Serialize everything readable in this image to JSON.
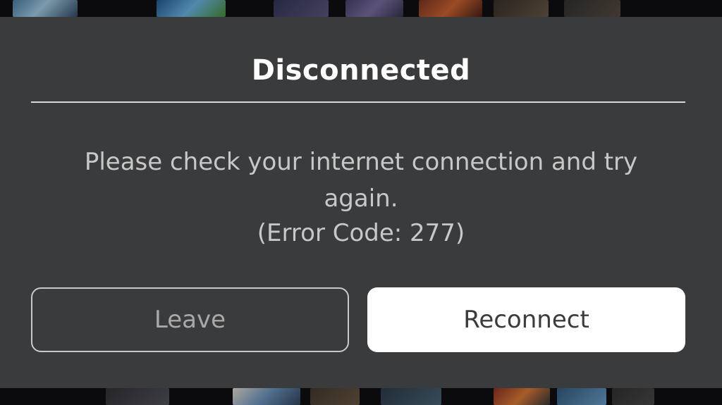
{
  "dialog": {
    "title": "Disconnected",
    "message_line1": "Please check your internet connection and try",
    "message_line2": "again.",
    "error_code": "(Error Code: 277)",
    "buttons": {
      "leave_label": "Leave",
      "reconnect_label": "Reconnect"
    }
  },
  "colors": {
    "dialog_background": "#393b3d",
    "title_text": "#ffffff",
    "body_text": "#c8c8c8",
    "primary_button": "#ffffff",
    "secondary_button_border": "#c9c9c9"
  }
}
